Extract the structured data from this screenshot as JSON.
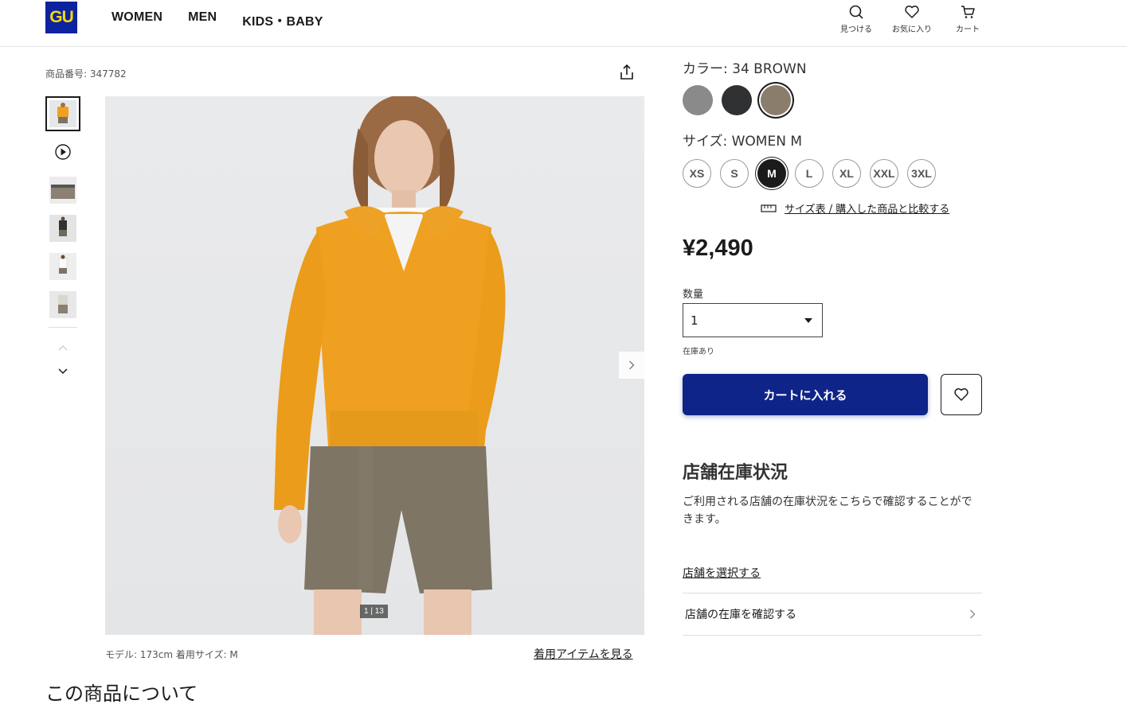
{
  "header": {
    "logo": "GU",
    "nav": [
      "WOMEN",
      "MEN",
      "KIDS・BABY"
    ],
    "icons": [
      {
        "label": "見つける",
        "icon": "search-icon"
      },
      {
        "label": "お気に入り",
        "icon": "heart-icon"
      },
      {
        "label": "カート",
        "icon": "cart-icon"
      }
    ]
  },
  "gallery": {
    "product_number": "商品番号: 347782",
    "counter": "1 | 13",
    "model_info": "モデル: 173cm 着用サイズ: M",
    "wear_items_link": "着用アイテムを見る"
  },
  "about_heading": "この商品について",
  "product": {
    "color_label": "カラー:  34 BROWN",
    "colors": [
      {
        "name": "gray",
        "hex": "#8a8a8a"
      },
      {
        "name": "dark-gray",
        "hex": "#2f3133"
      },
      {
        "name": "brown",
        "hex": "#8b7d6b",
        "selected": true
      }
    ],
    "size_label": "サイズ:  WOMEN M",
    "sizes": [
      "XS",
      "S",
      "M",
      "L",
      "XL",
      "XXL",
      "3XL"
    ],
    "selected_size": "M",
    "size_chart_link": "サイズ表 / 購入した商品と比較する",
    "price": "¥2,490",
    "quantity_label": "数量",
    "quantity_value": "1",
    "stock_status": "在庫あり",
    "add_to_cart": "カートに入れる"
  },
  "store": {
    "heading": "店舗在庫状況",
    "description": "ご利用される店舗の在庫状況をこちらで確認することができます。",
    "select_link": "店舗を選択する",
    "check_row": "店舗の在庫を確認する"
  },
  "colors": {
    "brand_blue": "#0f2488",
    "logo_yellow": "#f5d90a",
    "sweater": "#f0a020"
  }
}
